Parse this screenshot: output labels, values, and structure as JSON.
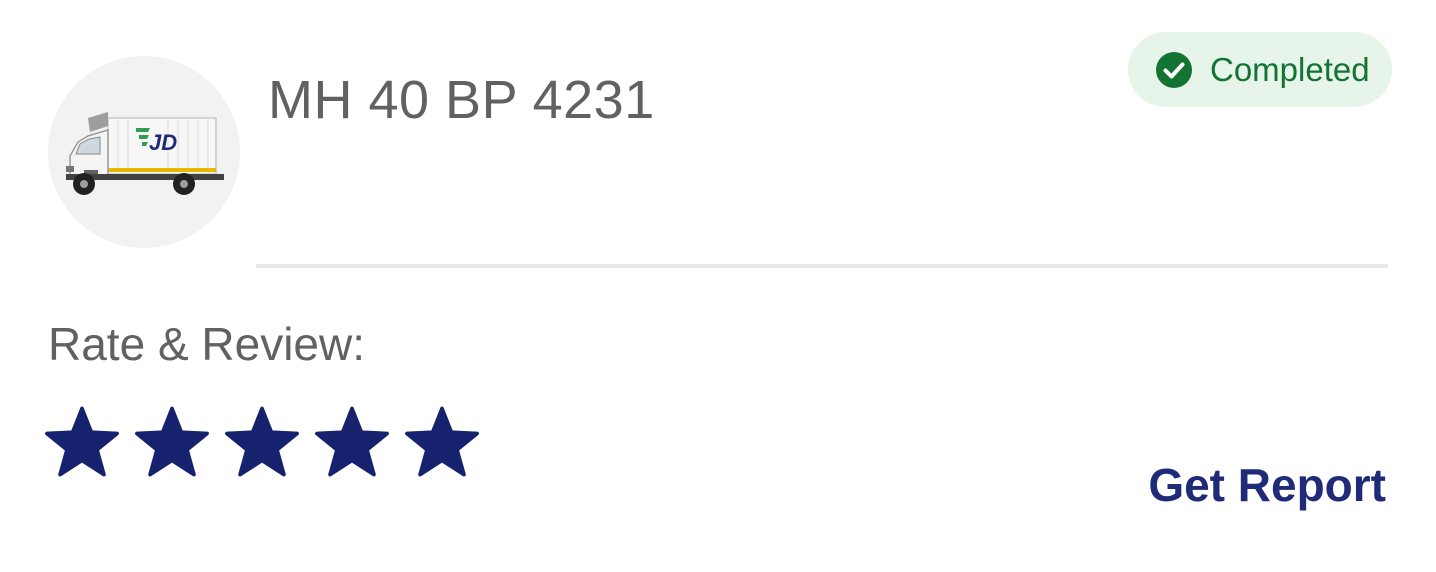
{
  "vehicle": {
    "plate_number": "MH 40 BP 4231",
    "image": "delivery-truck-icon",
    "brand_mark": "JD"
  },
  "status": {
    "label": "Completed",
    "icon": "check-circle-icon",
    "color": "#137333",
    "background": "#e6f4ea"
  },
  "review": {
    "label": "Rate & Review:",
    "rating": 5,
    "max_rating": 5,
    "star_icon": "star-icon",
    "star_color": "#17226f"
  },
  "actions": {
    "get_report_label": "Get Report"
  }
}
